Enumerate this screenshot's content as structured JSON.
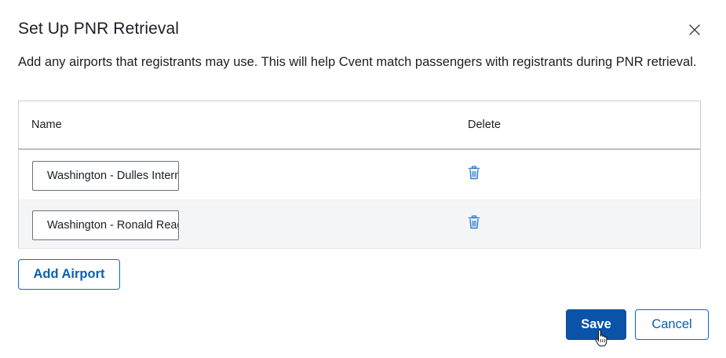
{
  "dialog": {
    "title": "Set Up PNR Retrieval",
    "description": "Add any airports that registrants may use. This will help Cvent match passengers with registrants during PNR retrieval."
  },
  "table": {
    "columns": [
      "Name",
      "Delete"
    ],
    "rows": [
      {
        "name": "Washington - Dulles International"
      },
      {
        "name": "Washington - Ronald Reagan National"
      }
    ]
  },
  "actions": {
    "add_airport": "Add Airport",
    "save": "Save",
    "cancel": "Cancel"
  },
  "icons": {
    "close": "close-icon",
    "delete": "trash-icon",
    "pointer": "hand-pointer-icon"
  },
  "colors": {
    "primary": "#0a53a8",
    "link": "#0b5fb3",
    "trash": "#2f7fd1"
  }
}
